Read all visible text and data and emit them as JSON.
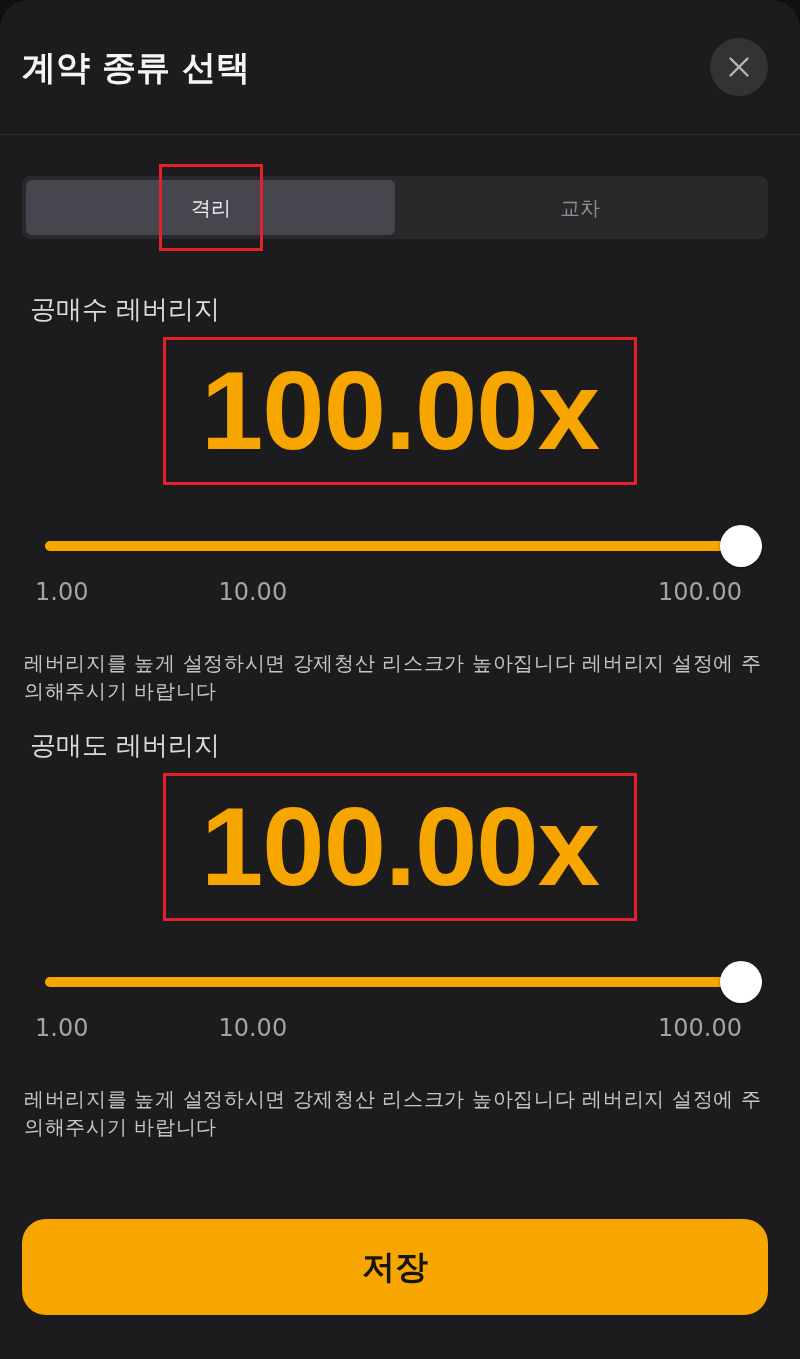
{
  "title": "계약 종류 선택",
  "tabs": [
    {
      "label": "격리",
      "selected": true,
      "highlighted": true
    },
    {
      "label": "교차",
      "selected": false,
      "highlighted": false
    }
  ],
  "sections": [
    {
      "label": "공매수 레버리지",
      "value": "100.00x",
      "highlighted": true,
      "level": 1,
      "ticks": [
        "1.00",
        "10.00",
        "100.00"
      ],
      "warning": "레버리지를 높게 설정하시면 강제청산 리스크가 높아집니다 레버리지 설정에 주의해주시기 바랍니다"
    },
    {
      "label": "공매도 레버리지",
      "value": "100.00x",
      "highlighted": true,
      "level": 1,
      "ticks": [
        "1.00",
        "10.00",
        "100.00"
      ],
      "warning": "레버리지를 높게 설정하시면 강제청산 리스크가 높아집니다 레버리지 설정에 주의해주시기 바랍니다"
    }
  ],
  "save_button": {
    "label": "저장"
  }
}
